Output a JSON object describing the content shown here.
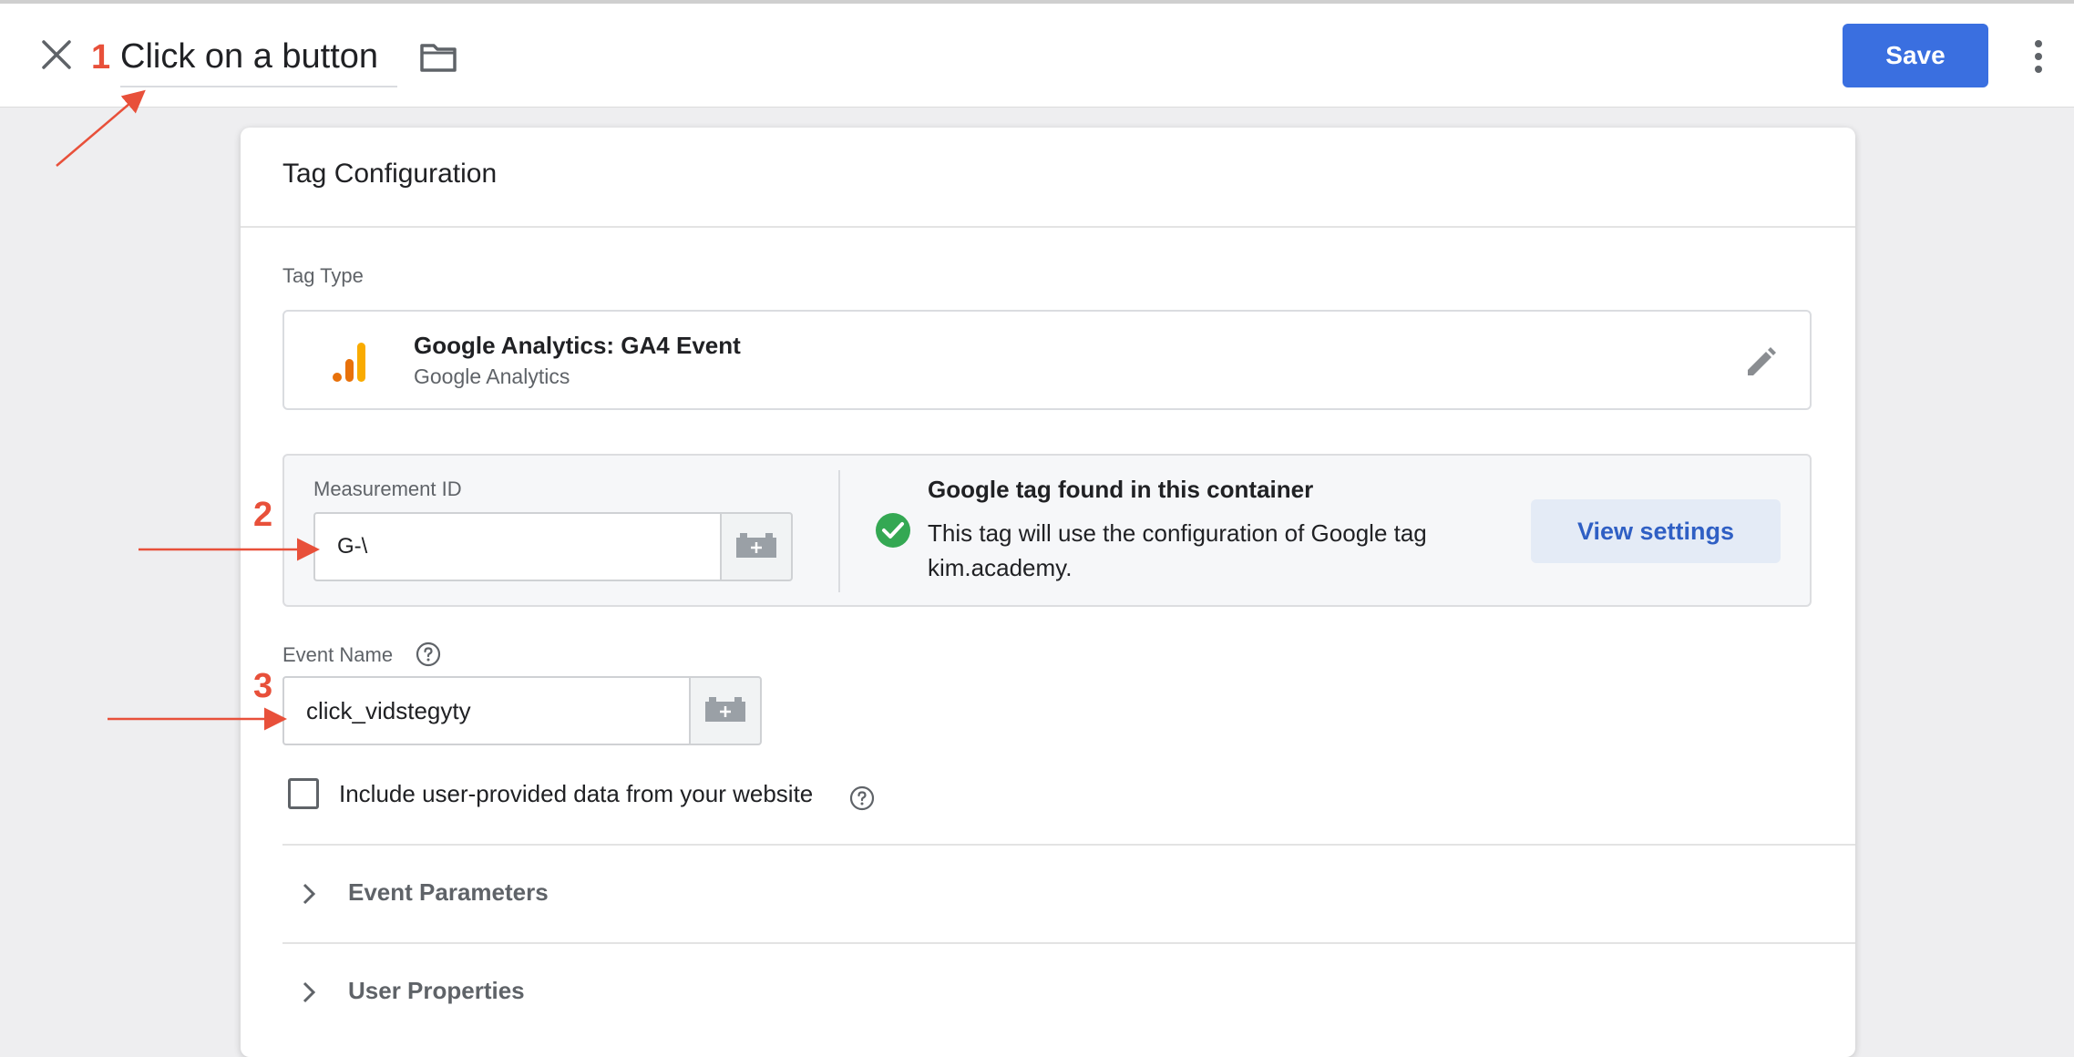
{
  "header": {
    "title": "Click on a button",
    "save_label": "Save"
  },
  "annotations": {
    "step1": "1",
    "step2": "2",
    "step3": "3"
  },
  "card": {
    "title": "Tag Configuration",
    "tag_type_label": "Tag Type",
    "tag_type": {
      "name": "Google Analytics: GA4 Event",
      "provider": "Google Analytics"
    },
    "measurement": {
      "label": "Measurement ID",
      "value": "G-\\",
      "found_title": "Google tag found in this container",
      "found_desc": "This tag will use the configuration of Google tag kim.academy.",
      "view_settings_label": "View settings"
    },
    "event": {
      "label": "Event Name",
      "value": "click_vidstegyty"
    },
    "include_user_data_label": "Include user-provided data from your website",
    "sections": [
      {
        "label": "Event Parameters"
      },
      {
        "label": "User Properties"
      }
    ]
  },
  "colors": {
    "accent": "#3a6fe0",
    "annotation": "#e8503a",
    "success": "#34a853",
    "ga_orange": "#e8710a",
    "ga_yellow": "#f9ab00"
  },
  "icons": {
    "close": "close-icon",
    "folder": "folder-icon",
    "more": "more-vert-icon",
    "edit": "pencil-icon",
    "check": "check-circle-icon",
    "variable": "variable-brick-icon",
    "help": "help-icon",
    "chevron": "chevron-right-icon"
  }
}
